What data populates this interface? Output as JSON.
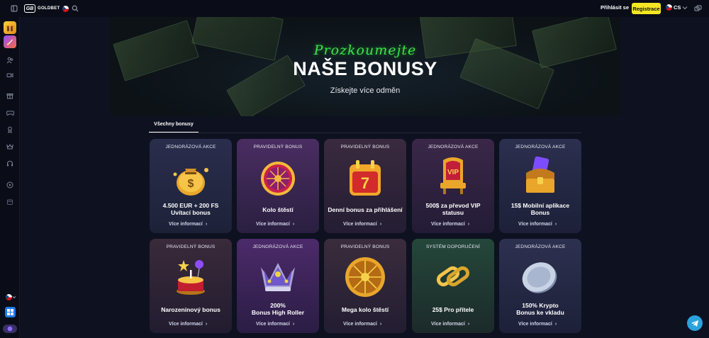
{
  "header": {
    "logo_mark": "GB",
    "logo_text": "GOLDBET",
    "login_label": "Přihlásit se",
    "register_label": "Registrace",
    "lang_label": "CS"
  },
  "hero": {
    "script_text": "Prozkoumejte",
    "title": "NAŠE BONUSY",
    "subtitle": "Získejte více odměn"
  },
  "tabs": [
    {
      "label": "Všechny bonusy"
    }
  ],
  "cards": [
    {
      "tag": "JEDNORÁZOVÁ AKCE",
      "title_line1": "4.500 EUR + 200 FS",
      "title_line2": "Uvítací bonus",
      "more": "Více informací",
      "art": "money-bag-icon"
    },
    {
      "tag": "PRAVIDELNÝ BONUS",
      "title_line1": "Kolo štěstí",
      "title_line2": "",
      "more": "Více informací",
      "art": "wheel-icon"
    },
    {
      "tag": "PRAVIDELNÝ BONUS",
      "title_line1": "Denní bonus za přihlášení",
      "title_line2": "",
      "more": "Více informací",
      "art": "calendar-icon"
    },
    {
      "tag": "JEDNORÁZOVÁ AKCE",
      "title_line1": "500$ za převod VIP",
      "title_line2": "statusu",
      "more": "Více informací",
      "art": "vip-throne-icon"
    },
    {
      "tag": "JEDNORÁZOVÁ AKCE",
      "title_line1": "15$ Mobilní aplikace",
      "title_line2": "Bonus",
      "more": "Více informací",
      "art": "treasure-chest-icon"
    },
    {
      "tag": "PRAVIDELNÝ BONUS",
      "title_line1": "Narozeninový bonus",
      "title_line2": "",
      "more": "Více informací",
      "art": "birthday-cake-icon"
    },
    {
      "tag": "JEDNORÁZOVÁ AKCE",
      "title_line1": "200%",
      "title_line2": "Bonus High Roller",
      "more": "Více informací",
      "art": "crown-icon"
    },
    {
      "tag": "PRAVIDELNÝ BONUS",
      "title_line1": "Mega kolo štěstí",
      "title_line2": "",
      "more": "Více informací",
      "art": "mega-wheel-icon"
    },
    {
      "tag": "SYSTÉM DOPORUČENÍ",
      "title_line1": "25$ Pro přítele",
      "title_line2": "",
      "more": "Více informací",
      "art": "chain-link-icon"
    },
    {
      "tag": "JEDNORÁZOVÁ AKCE",
      "title_line1": "150% Krypto",
      "title_line2": "Bonus ke vkladu",
      "more": "Více informací",
      "art": "crypto-coin-icon"
    }
  ],
  "colors": {
    "accent_yellow": "#f5e623",
    "script_green": "#3fe24a",
    "gold": "#f2b93b",
    "telegram": "#2aa3dc"
  }
}
